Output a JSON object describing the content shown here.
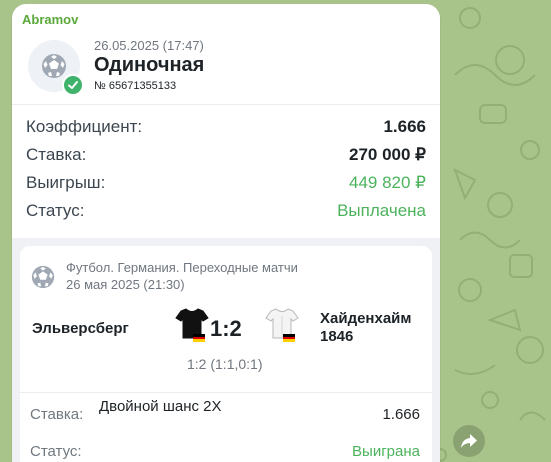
{
  "colors": {
    "chat_background": "#a9c48a",
    "sender_name": "#5aa83a",
    "win_green": "#4cb35c",
    "badge_green": "#3fb26b"
  },
  "message": {
    "sender": "Abramov"
  },
  "ticket": {
    "icon": "soccer-ball-icon",
    "status_icon": "check-icon",
    "date": "26.05.2025 (17:47)",
    "type": "Одиночная",
    "number": "№ 65671355133"
  },
  "summary": {
    "coefficient_label": "Коэффициент:",
    "coefficient_value": "1.666",
    "stake_label": "Ставка:",
    "stake_value": "270 000 ₽",
    "winnings_label": "Выигрыш:",
    "winnings_value": "449 820 ₽",
    "status_label": "Статус:",
    "status_value": "Выплачена"
  },
  "event": {
    "league": "Футбол. Германия. Переходные матчи",
    "date": "26 мая 2025 (21:30)",
    "home_team": "Эльверсберг",
    "away_team": "Хайденхайм 1846",
    "score": "1:2",
    "score_detail": "1:2 (1:1,0:1)",
    "home_jersey_icon": "black-jersey-icon",
    "away_jersey_icon": "white-jersey-icon",
    "flag_icon": "germany-flag-icon",
    "bet_label": "Ставка:",
    "bet_outcome": "Двойной шанс 2Х",
    "bet_odds": "1.666",
    "status_label": "Статус:",
    "status_value": "Выиграна"
  },
  "actions": {
    "forward_icon": "forward-arrow-icon"
  }
}
